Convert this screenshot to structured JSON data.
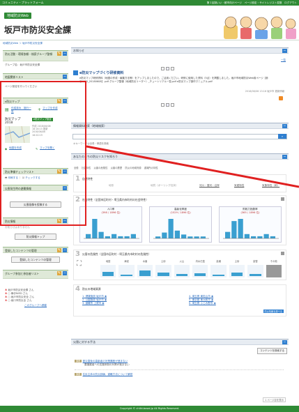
{
  "topbar": {
    "title": "コミュニティ・プラットフォーム",
    "links": "第１区制いい・都市向けページ　ページ設定・サイトレジスト変数　ログアウト"
  },
  "header": {
    "badge": "地域防災Web",
    "title": "坂戸市防災安全課"
  },
  "breadcrumb": "地域防災Web ＞ 坂戸市防災安全課",
  "sidebar": {
    "s1": {
      "head": "防災活動・環境依頼・検索グループ整頓",
      "body": "グループ名：坂戸市防災安全課"
    },
    "s2": {
      "head": "地図関係リスト",
      "body": "ページ設定を行ってください"
    },
    "s3": {
      "head": "e防災マップ",
      "i1": "作成済み　施行一覧",
      "i2": "マップを作成",
      "map_title": "防災マップ　2018",
      "link": "e防災マップ設定",
      "meta": "作成 2018/06/08\n16:16:15 更新\n2018/06/08\n16:20:19",
      "a1": "地図を作成",
      "a2": "マップを開く"
    },
    "s4": {
      "head": "防災準備チェックリスト",
      "a": "印刷する",
      "b": "チェックする"
    },
    "s5": {
      "head": "災害発生時の避難情報"
    },
    "btn_request": "災害画像を投稿する",
    "s6": {
      "head": "防災情報",
      "body": "お知らせはありません",
      "btn": "防災情報トップ"
    },
    "s7": {
      "head": "登録したコンテンツの管理",
      "btn": "登録したコンテンツの管理"
    },
    "s8": {
      "head": "グループ参加と参加者リスト",
      "members": [
        "坂戸市防災安全課 さん",
        "○ 事@NIED さん",
        "○ 坂戸市防災安全 さん",
        "○ 坂口市防災全 さん"
      ],
      "more": "このグループへ移動"
    }
  },
  "main": {
    "notice": {
      "head": "お知らせ",
      "more": "一覧"
    },
    "news": {
      "title": "e防災マップづくり研修資料",
      "text": "e防災マップ研修資料（地図の作成・編集方法等）をアップしましたので、ご活用ください。研修に使用した資料（5点）を掲載しました。坂戸市地域防災Web用ページ【参@NIED_20180608】.pdf グループ整頓（地域防災リーダー）_チュートリアル一覧.pdf e防災マップ操作マニュアル.pdf",
      "meta": "2018/06/06 13:18 坂戸市 更新情報"
    },
    "search": {
      "head": "情報資料検索（地域検索）",
      "placeholder": "キーワードを入力して検索",
      "hint": "キキーワードは全角・単語を検索"
    },
    "risk": {
      "head": "あなたのまちの防災リスクを知ろう",
      "tabs": [
        "全般",
        "社会特性",
        "災害の危険性",
        "災害の履歴",
        "防災の地域資源",
        "避難所の特性"
      ]
    },
    "row1": {
      "num": "1",
      "label": "自然特性",
      "cols": [
        "地形",
        "地質（ボーリング柱状）",
        "河川・運河・沿岸",
        "気候特性",
        "気象特性（雨）"
      ]
    },
    "row2": {
      "num": "2",
      "label": "社会特性（全国市区町村・埼玉県内市町村の社会特性）"
    },
    "charts": [
      {
        "title": "人口率",
        "sub": "(398 / 1896 位)"
      },
      {
        "title": "高齢化率度",
        "sub": "(1529 / 1896 位)"
      },
      {
        "title": "財政力指数率",
        "sub": "(365 / 1896 位)"
      }
    ],
    "row3": {
      "num": "3",
      "label": "災害の危険性（全国市区町村・埼玉県内市町村の危険性）",
      "cols": [
        "地震",
        "津波",
        "水害",
        "土砂",
        "火山",
        "内水氾濫",
        "高潮",
        "土砂",
        "豪雪",
        "その他"
      ]
    },
    "row4": {
      "num": "4",
      "label": "防災の地域資源",
      "items_left": [
        "1. 健康施設 坂戸市 ◉",
        "2. 公園施設 坂戸市 ◉",
        "3. 避難所 上尾市 ◉"
      ],
      "items_right": [
        "4. 埼玉県 東松山市 ◉",
        "5. 東京都 東大和市 ◉",
        "6. 埼玉県 ふじみ野市 ◉"
      ],
      "more": "防災情報を調べる"
    },
    "measures": {
      "head": "災害に対する手法",
      "filter": "コンテンツを検索する",
      "rows": [
        {
          "badge": "講座",
          "text": "被災直後の高齢者の対策講座が進まない",
          "sub": "要援護者への支援体制の対策が進まない"
        },
        {
          "badge": "講座",
          "text": "住民主体の防災訓練、避難方法について解説"
        }
      ],
      "page": "1 ページ目を表示"
    }
  },
  "footer": "Copyright © chiiki-bosai.jp All Rights Reserved.",
  "colors": {
    "green": "#2f8a35",
    "blue": "#2f7fd0",
    "annotation_red": "#e02020"
  },
  "chart_data": [
    {
      "type": "bar",
      "title": "人口率",
      "values": [
        2,
        9,
        3,
        1,
        2,
        1,
        1,
        2
      ]
    },
    {
      "type": "bar",
      "title": "高齢化率度",
      "values": [
        1,
        3,
        10,
        4,
        2,
        1,
        1,
        1
      ]
    },
    {
      "type": "bar",
      "title": "財政力指数率",
      "values": [
        3,
        8,
        9,
        2,
        1,
        1,
        2,
        1
      ]
    }
  ]
}
